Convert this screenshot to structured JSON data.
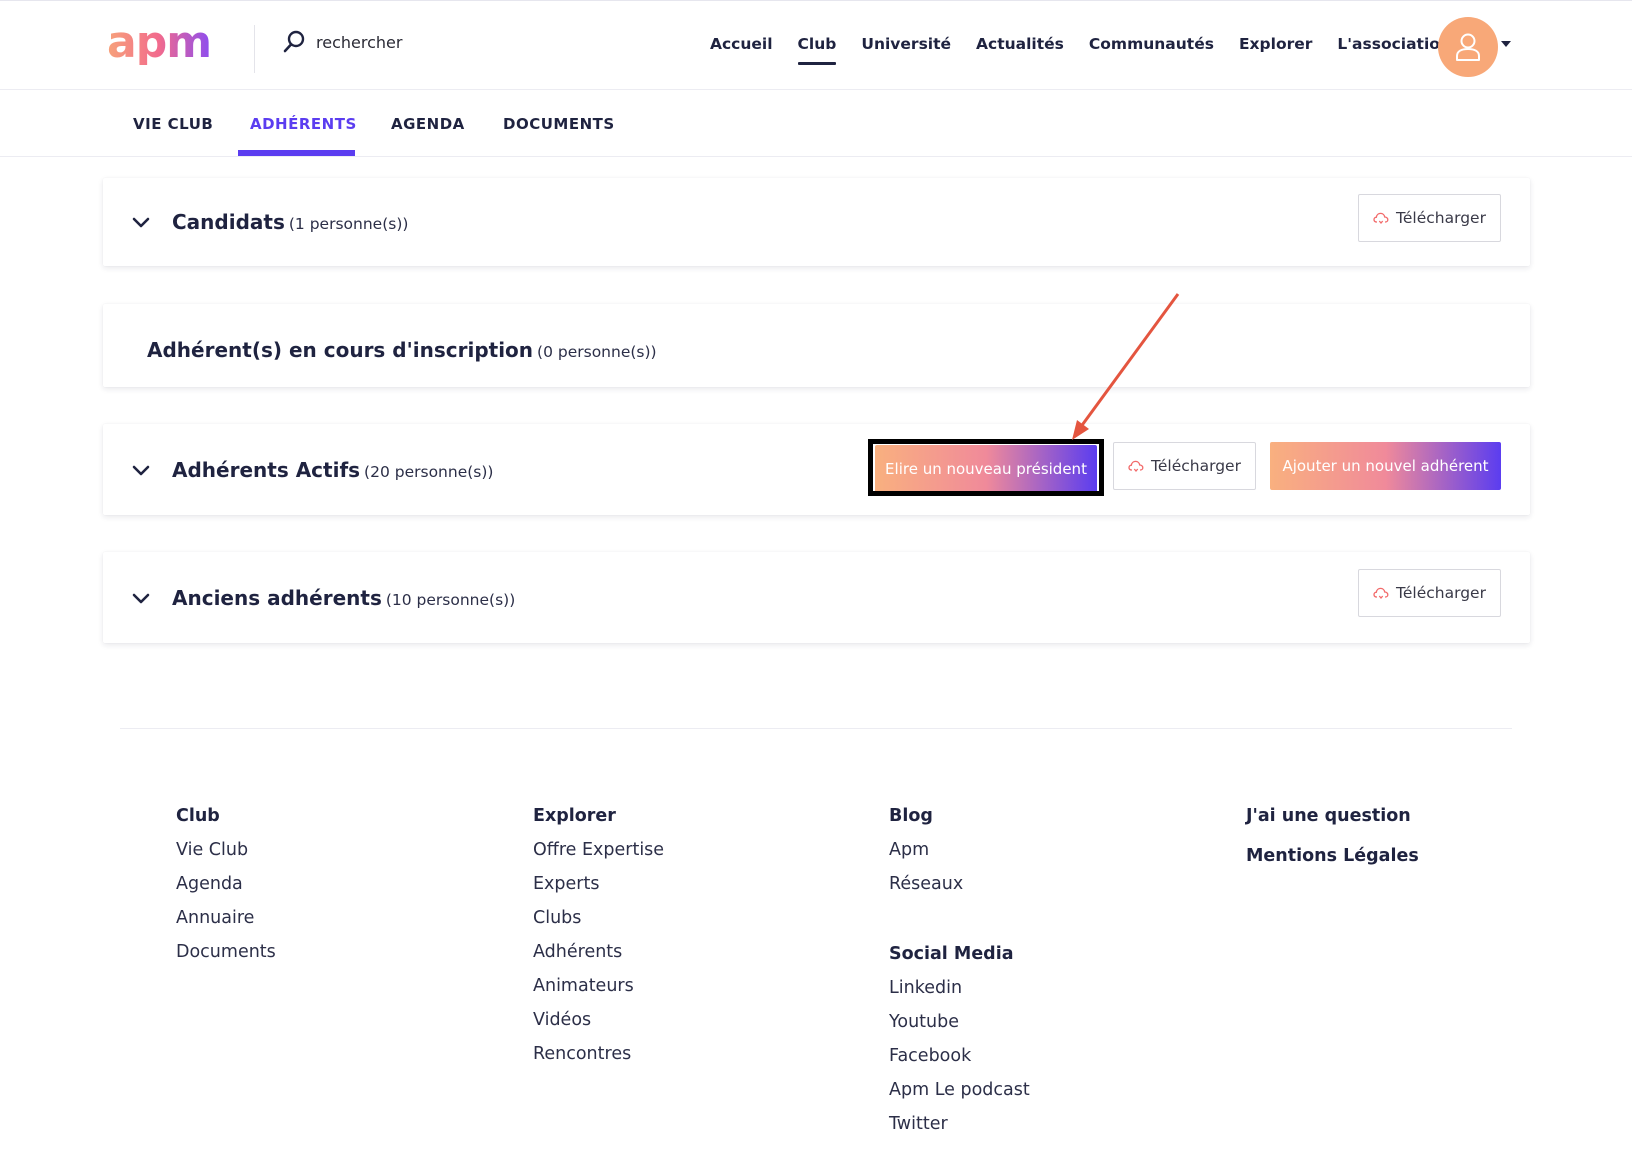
{
  "header": {
    "logo": "apm",
    "search_placeholder": "rechercher",
    "nav": [
      "Accueil",
      "Club",
      "Université",
      "Actualités",
      "Communautés",
      "Explorer",
      "L'association"
    ],
    "active_nav": "Club"
  },
  "subtabs": {
    "items": [
      "VIE CLUB",
      "ADHÉRENTS",
      "AGENDA",
      "DOCUMENTS"
    ],
    "active": "ADHÉRENTS"
  },
  "sections": {
    "candidats": {
      "title": "Candidats",
      "count": "(1 personne(s))",
      "download": "Télécharger"
    },
    "en_cours": {
      "title": "Adhérent(s) en cours d'inscription",
      "count": "(0 personne(s))"
    },
    "actifs": {
      "title": "Adhérents Actifs",
      "count": "(20 personne(s))",
      "elect": "Elire un nouveau président",
      "download": "Télécharger",
      "add": "Ajouter un nouvel adhérent"
    },
    "anciens": {
      "title": "Anciens adhérents",
      "count": "(10 personne(s))",
      "download": "Télécharger"
    }
  },
  "footer": {
    "club": {
      "title": "Club",
      "links": [
        "Vie Club",
        "Agenda",
        "Annuaire",
        "Documents"
      ]
    },
    "explorer": {
      "title": "Explorer",
      "links": [
        "Offre Expertise",
        "Experts",
        "Clubs",
        "Adhérents",
        "Animateurs",
        "Vidéos",
        "Rencontres"
      ]
    },
    "blog": {
      "title": "Blog",
      "links": [
        "Apm",
        "Réseaux"
      ]
    },
    "social": {
      "title": "Social Media",
      "links": [
        "Linkedin",
        "Youtube",
        "Facebook",
        "Apm Le podcast",
        "Twitter"
      ]
    },
    "question": "J'ai une question",
    "legal": "Mentions Légales"
  },
  "colors": {
    "accent": "#5b3df0",
    "avatar": "#f8a878",
    "annotation_arrow": "#e4553f"
  }
}
